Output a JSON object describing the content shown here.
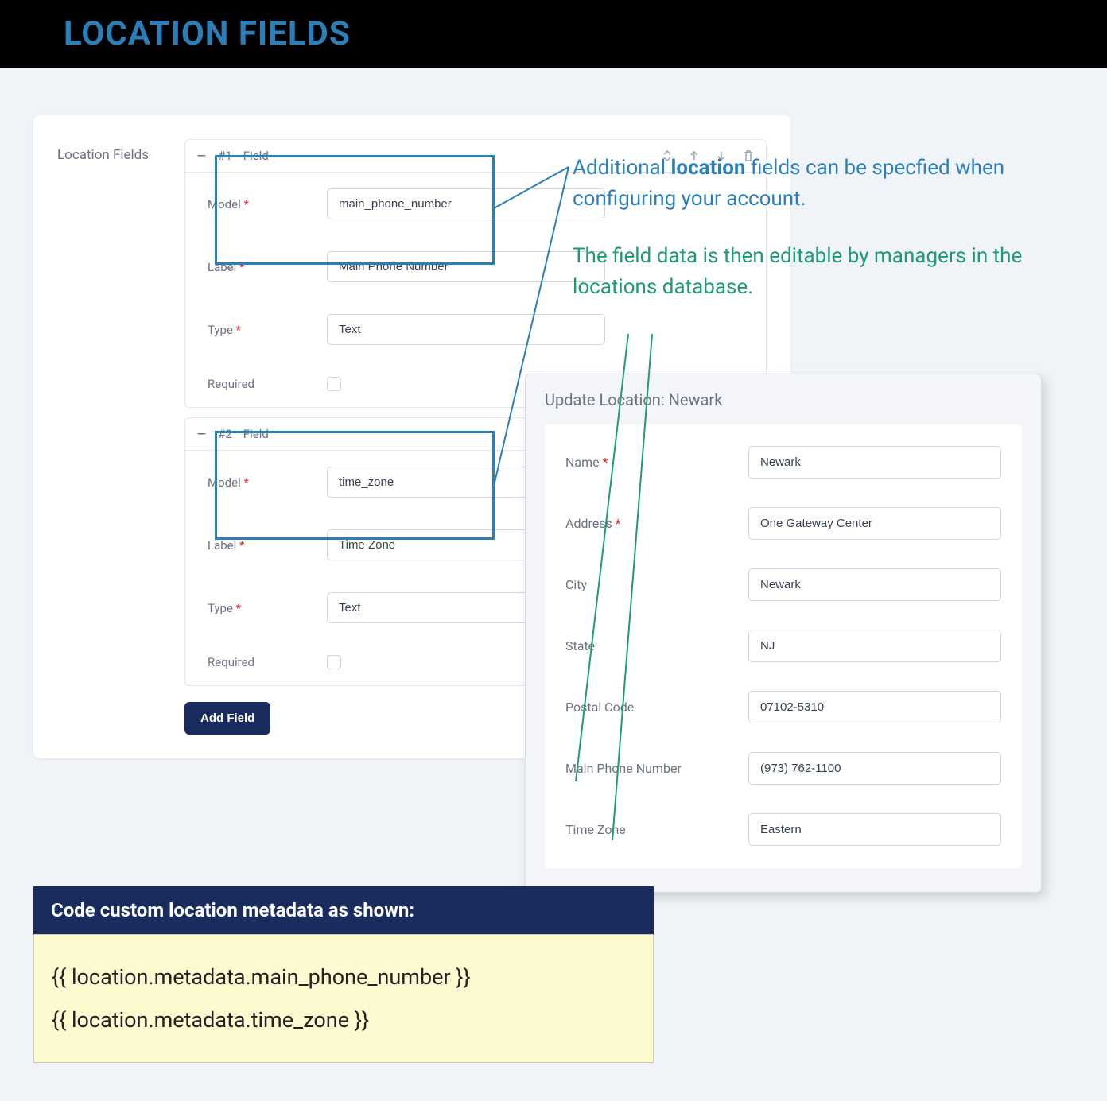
{
  "header": {
    "title": "LOCATION FIELDS"
  },
  "card": {
    "side_label": "Location Fields",
    "add_button": "Add Field",
    "fields": [
      {
        "num": "#1",
        "word": "Field",
        "rows": {
          "model_label": "Model",
          "model_value": "main_phone_number",
          "label_label": "Label",
          "label_value": "Main Phone Number",
          "type_label": "Type",
          "type_value": "Text",
          "required_label": "Required"
        }
      },
      {
        "num": "#2",
        "word": "Field",
        "rows": {
          "model_label": "Model",
          "model_value": "time_zone",
          "label_label": "Label",
          "label_value": "Time Zone",
          "type_label": "Type",
          "type_value": "Text",
          "required_label": "Required"
        }
      }
    ]
  },
  "annot1": {
    "pre": "Additional ",
    "bold": "location",
    "post": " fields can be specfied when configuring your account."
  },
  "annot2": "The field data is then editable by managers in the locations database.",
  "panel": {
    "title": "Update Location: Newark",
    "rows": [
      {
        "label": "Name",
        "req": true,
        "value": "Newark"
      },
      {
        "label": "Address",
        "req": true,
        "value": "One Gateway Center"
      },
      {
        "label": "City",
        "req": false,
        "value": "Newark"
      },
      {
        "label": "State",
        "req": false,
        "value": "NJ"
      },
      {
        "label": "Postal Code",
        "req": false,
        "value": "07102-5310"
      },
      {
        "label": "Main Phone Number",
        "req": false,
        "value": "(973) 762-1100"
      },
      {
        "label": "Time Zone",
        "req": false,
        "value": "Eastern"
      }
    ]
  },
  "code": {
    "header": "Code custom location metadata as shown:",
    "line1": "{{ location.metadata.main_phone_number }}",
    "line2": "{{ location.metadata.time_zone }}"
  }
}
